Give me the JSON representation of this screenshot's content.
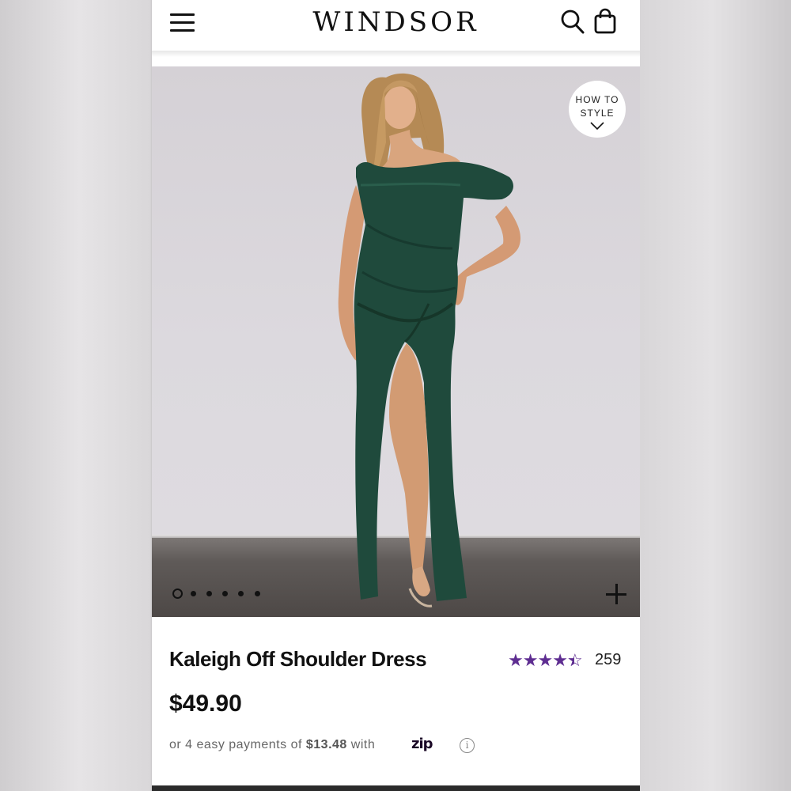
{
  "header": {
    "logo_text": "WINDSOR",
    "menu_icon": "hamburger-menu-icon",
    "search_icon": "search-icon",
    "bag_icon": "shopping-bag-icon"
  },
  "hero": {
    "how_to_style_line1": "HOW TO",
    "how_to_style_line2": "STYLE",
    "carousel_total": 6,
    "carousel_active": 1
  },
  "product": {
    "title": "Kaleigh Off Shoulder Dress",
    "rating_value": 4.5,
    "rating_count": "259",
    "price": "$49.90",
    "installment_prefix": "or 4 easy payments of",
    "installment_amount": "$13.48",
    "installment_suffix": "with",
    "provider": "zip"
  },
  "colors": {
    "star": "#5e2d91",
    "dress": "#1f4a3c",
    "zip_accent": "#aa8fff"
  }
}
